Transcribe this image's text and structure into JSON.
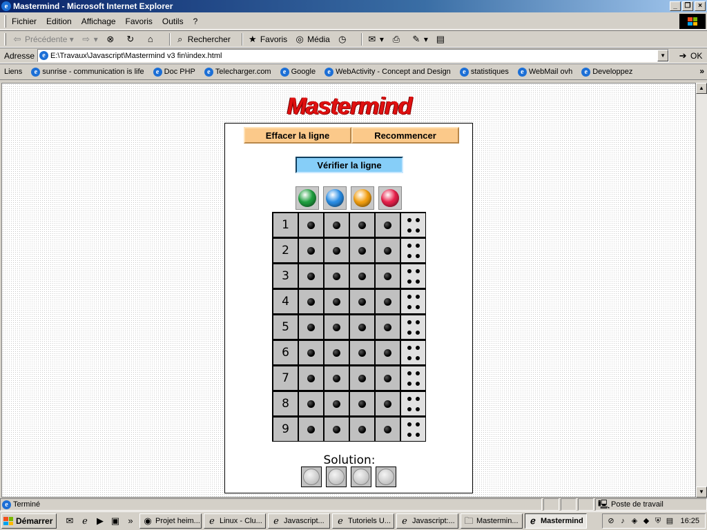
{
  "window": {
    "title": "Mastermind - Microsoft Internet Explorer"
  },
  "menu": [
    "Fichier",
    "Edition",
    "Affichage",
    "Favoris",
    "Outils",
    "?"
  ],
  "toolbar": {
    "back": "Précédente",
    "search": "Rechercher",
    "favorites": "Favoris",
    "media": "Média"
  },
  "address": {
    "label": "Adresse",
    "url": "E:\\Travaux\\Javascript\\Mastermind v3 fin\\index.html",
    "go": "OK"
  },
  "links": {
    "label": "Liens",
    "items": [
      "sunrise - communication is life",
      "Doc PHP",
      "Telecharger.com",
      "Google",
      "WebActivity - Concept and Design",
      "statistiques",
      "WebMail ovh",
      "Developpez"
    ]
  },
  "game": {
    "logo": "Mastermind",
    "clear_line": "Effacer la ligne",
    "restart": "Recommencer",
    "verify": "Vérifier la ligne",
    "palette": [
      "#20a040",
      "#2a8ee6",
      "#f4a010",
      "#e8204a"
    ],
    "palette_names": [
      "green-ball-icon",
      "blue-ball-icon",
      "orange-ball-icon",
      "red-ball-icon"
    ],
    "rows": [
      "1",
      "2",
      "3",
      "4",
      "5",
      "6",
      "7",
      "8",
      "9"
    ],
    "solution_label": "Solution:"
  },
  "status": {
    "text": "Terminé",
    "zone": "Poste de travail"
  },
  "taskbar": {
    "start": "Démarrer",
    "tasks": [
      "Projet heim...",
      "Linux - Clu...",
      "Javascript...",
      "Tutoriels U...",
      "Javascript:...",
      "Mastermin...",
      "Mastermind"
    ],
    "clock": "16:25"
  }
}
